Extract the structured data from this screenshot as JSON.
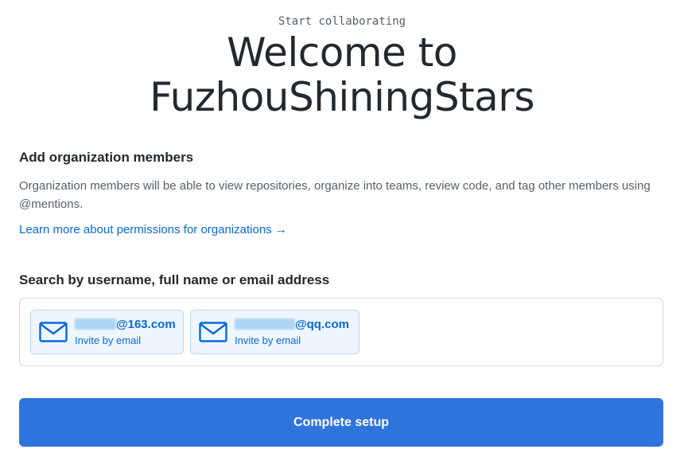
{
  "header": {
    "eyebrow": "Start collaborating",
    "title_line1": "Welcome to",
    "title_line2": "FuzhouShiningStars"
  },
  "members": {
    "section_title": "Add organization members",
    "description": "Organization members will be able to view repositories, organize into teams, review code, and tag other members using @mentions.",
    "learn_link": "Learn more about permissions for organizations →",
    "search_label": "Search by username, full name or email address",
    "invites": [
      {
        "email_suffix": "@163.com",
        "sub_label": "Invite by email",
        "icon": "mail-icon"
      },
      {
        "email_suffix": "@qq.com",
        "sub_label": "Invite by email",
        "icon": "mail-icon"
      }
    ]
  },
  "actions": {
    "complete_label": "Complete setup"
  },
  "colors": {
    "accent": "#0969da",
    "button": "#2f74dd",
    "chip_bg": "#eef6ff"
  }
}
